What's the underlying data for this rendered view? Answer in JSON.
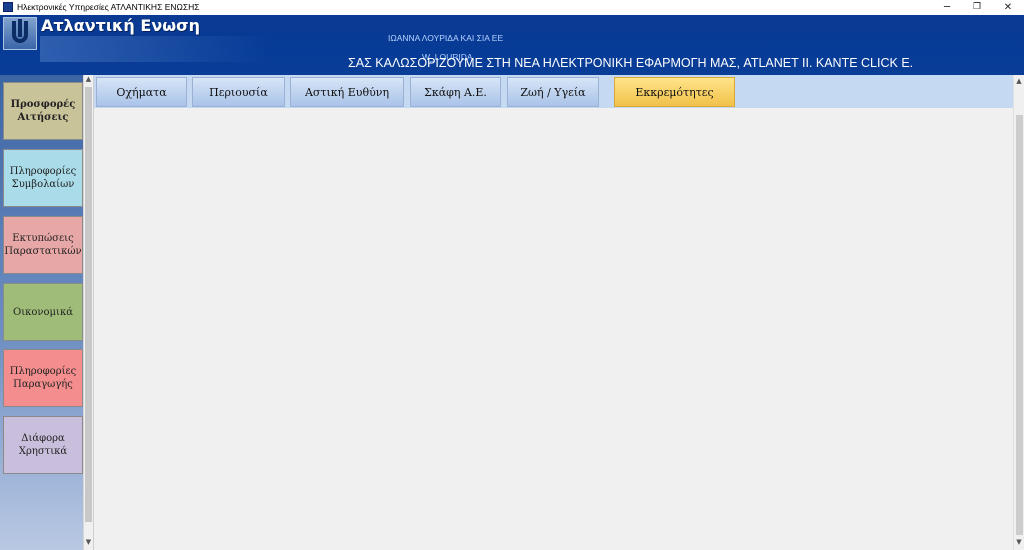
{
  "window": {
    "title": "Ηλεκτρονικές Υπηρεσίες ΑΤΛΑΝΤΙΚΗΣ ΕΝΩΣΗΣ",
    "minimize": "─",
    "maximize": "❐",
    "close": "✕"
  },
  "header": {
    "brand": "Ατλαντική Ενωση",
    "company": "ΙΩΑΝΝΑ ΛΟΥΡΙΔΑ ΚΑΙ ΣΙΑ ΕΕ",
    "username": "W_LOURIDA",
    "welcome": "ΣΑΣ ΚΑΛΩΣΟΡΙΖΟΥΜΕ  ΣΤΗ ΝΕΑ ΗΛΕΚΤΡΟΝΙΚΗ ΕΦΑΡΜΟΓΗ ΜΑΣ, ATLANET II. ΚΑΝΤΕ CLICK Ε."
  },
  "sidebar": {
    "items": [
      {
        "label": "Προσφορές\nΑιτήσεις",
        "color": "#c9c39a",
        "bold": true
      },
      {
        "label": "Πληροφορίες\nΣυμβολαίων",
        "color": "#a9dbe8",
        "bold": false
      },
      {
        "label": "Εκτυπώσεις\nΠαραστατικών",
        "color": "#e8a7a7",
        "bold": false
      },
      {
        "label": "Οικονομικά",
        "color": "#9fbd78",
        "bold": false
      },
      {
        "label": "Πληροφορίες\nΠαραγωγής",
        "color": "#f48e8e",
        "bold": false
      },
      {
        "label": "Διάφορα\nΧρηστικά",
        "color": "#c9bedc",
        "bold": false
      }
    ],
    "scroll_up": "▲",
    "scroll_down": "▼"
  },
  "tabs": [
    {
      "label": "Οχήματα",
      "active": false
    },
    {
      "label": "Περιουσία",
      "active": false
    },
    {
      "label": "Αστική Ευθύνη",
      "active": false
    },
    {
      "label": "Σκάφη Α.Ε.",
      "active": false
    },
    {
      "label": "Ζωή / Υγεία",
      "active": false
    },
    {
      "label": "Εκκρεμότητες",
      "active": true
    }
  ],
  "main_scroll": {
    "up": "▲",
    "down": "▼"
  }
}
